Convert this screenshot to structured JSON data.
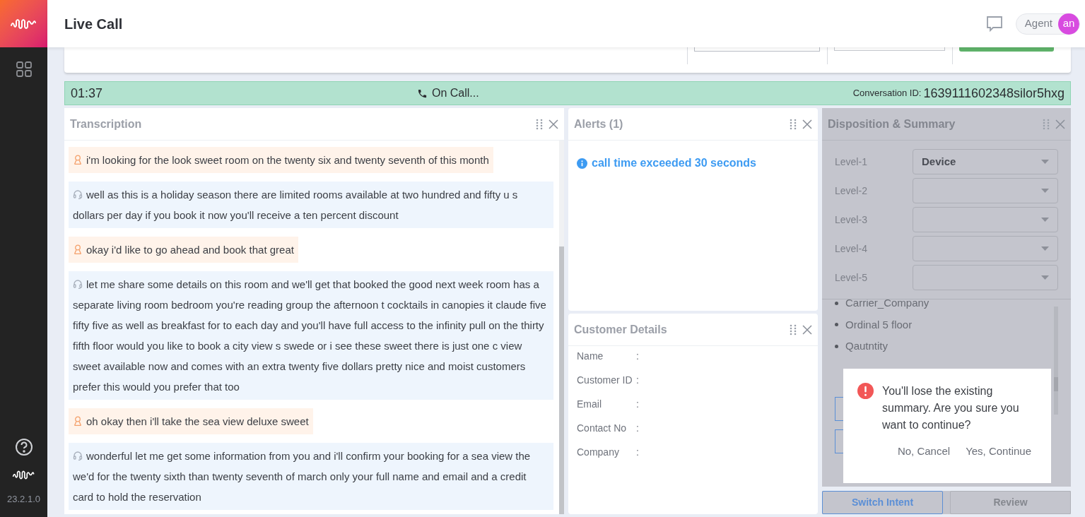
{
  "sidebar": {
    "version": "23.2.1.0"
  },
  "header": {
    "title": "Live Call",
    "user": {
      "label": "Agent",
      "initials": "an"
    }
  },
  "status_bar": {
    "timer": "01:37",
    "status": "On Call...",
    "conversation_label": "Conversation ID:",
    "conversation_id": "1639111602348silor5hxg"
  },
  "transcription": {
    "title": "Transcription",
    "messages": [
      {
        "kind": "customer",
        "text": "i'm looking for the look sweet room on the twenty six and twenty seventh of this month"
      },
      {
        "kind": "agent",
        "text": "well as this is a holiday season there are limited rooms available at two hundred and fifty u s dollars per day if you book it now you'll receive a ten percent discount"
      },
      {
        "kind": "customer",
        "text": "okay i'd like to go ahead and book that great"
      },
      {
        "kind": "agent",
        "text": "let me share some details on this room and we'll get that booked the good next week room has a separate living room bedroom you're reading group the afternoon t cocktails in canopies it claude five fifty five as well as breakfast for to each day and you'll have full access to the infinity pull on the thirty fifth floor would you like to book a city view s swede or i see these sweet there is just one c view sweet available now and comes with an extra twenty five dollars pretty nice and moist customers prefer this would you prefer that too"
      },
      {
        "kind": "customer",
        "text": "oh okay then i'll take the sea view deluxe sweet"
      },
      {
        "kind": "agent",
        "text": "wonderful let me get some information from you and i'll confirm your booking for a sea view the we'd for the twenty sixth than twenty seventh of march only your full name and email and a credit card to hold the reservation"
      }
    ]
  },
  "alerts": {
    "title": "Alerts (1)",
    "items": [
      "call time exceeded 30 seconds"
    ]
  },
  "customer_details": {
    "title": "Customer Details",
    "fields": [
      {
        "label": "Name",
        "separator": ":"
      },
      {
        "label": "Customer ID",
        "separator": ":"
      },
      {
        "label": "Email",
        "separator": ":"
      },
      {
        "label": "Contact No",
        "separator": ":"
      },
      {
        "label": "Company",
        "separator": ":"
      }
    ]
  },
  "disposition": {
    "title": "Disposition & Summary",
    "levels": [
      {
        "label": "Level-1",
        "value": "Device"
      },
      {
        "label": "Level-2"
      },
      {
        "label": "Level-3"
      },
      {
        "label": "Level-4"
      },
      {
        "label": "Level-5"
      }
    ],
    "summary": [
      "Carrier_Company",
      "Ordinal 5 floor",
      "Qautntity"
    ],
    "buttons": [
      {
        "label": "Switch Intent",
        "disabled": false
      },
      {
        "label": "Review",
        "disabled": true
      }
    ]
  },
  "dialog": {
    "message": "You'll lose the existing summary. Are you sure you want to continue?",
    "buttons": [
      "No, Cancel",
      "Yes, Continue"
    ]
  }
}
